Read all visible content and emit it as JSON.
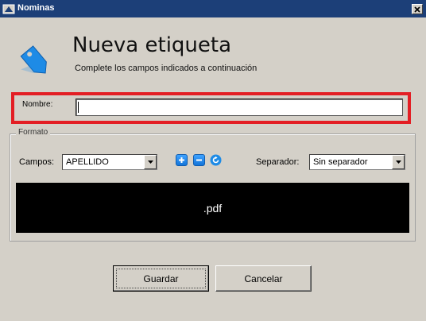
{
  "window": {
    "title": "Nominas"
  },
  "header": {
    "title": "Nueva etiqueta",
    "subtitle": "Complete los campos indicados a continuación"
  },
  "nombre": {
    "label": "Nombre:",
    "value": ""
  },
  "formato": {
    "legend": "Formato",
    "campos_label": "Campos:",
    "campos_value": "APELLIDO",
    "separador_label": "Separador:",
    "separador_value": "Sin separador",
    "preview_text": ".pdf"
  },
  "buttons": {
    "save_label": "Guardar",
    "cancel_label": "Cancelar"
  },
  "colors": {
    "titlebar": "#1c3f78",
    "highlight": "#e31e24",
    "accent_icon": "#1e8be6"
  }
}
